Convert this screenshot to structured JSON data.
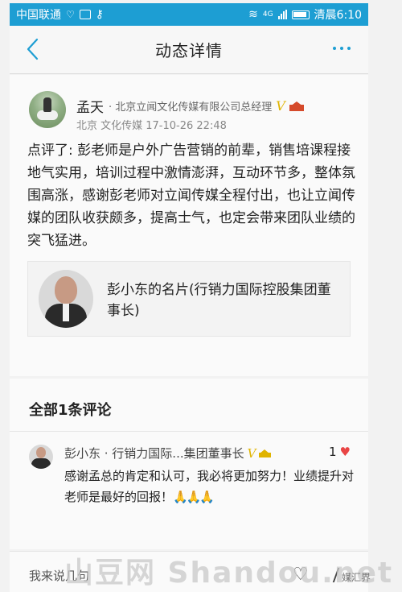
{
  "status_bar": {
    "carrier": "中国联通",
    "time": "清晨6:10",
    "network": "4G"
  },
  "header": {
    "title": "动态详情"
  },
  "post": {
    "author": "孟天",
    "author_title": "· 北京立闻文化传媒有限公司总经理",
    "verified_badge": "V",
    "meta": "北京 文化传媒 17-10-26 22:48",
    "content": "点评了: 彭老师是户外广告营销的前辈，销售培课程接地气实用，培训过程中激情澎湃，互动环节多，整体氛围高涨，感谢彭老师对立闻传媒全程付出，也让立闻传媒的团队收获颇多，提高士气，也定会带来团队业绩的突飞猛进。",
    "card_text": "彭小东的名片(行销力国际控股集团董事长)"
  },
  "comments": {
    "title": "全部1条评论",
    "items": [
      {
        "author": "彭小东 · 行销力国际...集团董事长",
        "verified_badge": "V",
        "likes": "1",
        "text": "感谢孟总的肯定和认可，我必将更加努力！业绩提升对老师是最好的回报！",
        "emoji": "🙏🙏🙏"
      }
    ]
  },
  "footer": {
    "input_placeholder": "我来说几句"
  },
  "watermark": {
    "text": "山豆网 Shandou.net",
    "small": "媒汇界"
  }
}
